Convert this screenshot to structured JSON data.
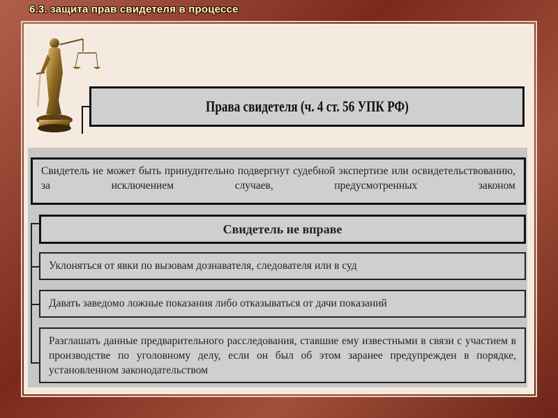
{
  "slide": {
    "title": "6.3. защита прав свидетеля в процессе"
  },
  "header": {
    "text": "Права свидетеля (ч. 4 ст. 56 УПК РФ)"
  },
  "boxes": {
    "expertise": "Свидетель не может быть принудительно подвергнут судебной экспертизе или освидетельствованию, за исключением случаев, предусмотренных законом",
    "not_entitled_title": "Свидетель не вправе",
    "item1": "Уклоняться от явки по вызовам дознавателя, следователя или в суд",
    "item2": "Давать заведомо ложные показания либо отказываться от дачи показаний",
    "item3": "Разглашать данные предварительного расследования, ставшие ему известными в связи с участием в производстве по уголовному делу, если он был об этом заранее предупрежден в порядке, установленном законодательством"
  },
  "colors": {
    "frame": "#8a3a2a",
    "content_bg": "#f5eadf",
    "box_bg": "#cfcfcf",
    "title_text": "#fff6c0"
  },
  "icons": {
    "statue": "themis-statue-icon"
  }
}
